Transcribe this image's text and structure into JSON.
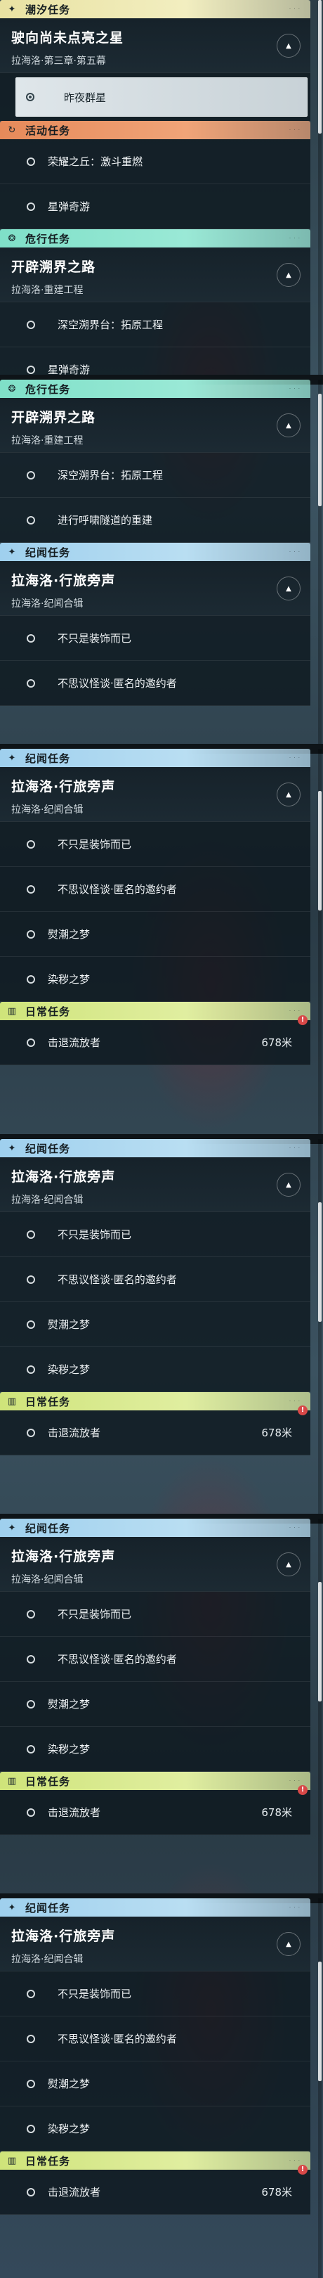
{
  "shots": [
    {
      "panel": [
        {
          "kind": "cat",
          "style": "gold",
          "icon": "✦",
          "icon_name": "sparkle-icon",
          "label": "潮汐任务"
        },
        {
          "kind": "head",
          "title": "驶向尚未点亮之星",
          "sub": "拉海洛·第三章·第五幕"
        },
        {
          "kind": "quest",
          "variant": "sel",
          "label": "昨夜群星"
        },
        {
          "kind": "cat",
          "style": "orange",
          "icon": "↻",
          "icon_name": "activity-icon",
          "label": "活动任务"
        },
        {
          "kind": "quest",
          "variant": "plain",
          "label": "荣耀之丘：激斗重燃"
        },
        {
          "kind": "quest",
          "variant": "plain",
          "label": "星弹奇游"
        },
        {
          "kind": "cat",
          "style": "teal",
          "icon": "❂",
          "icon_name": "danger-task-icon",
          "label": "危行任务"
        },
        {
          "kind": "head",
          "title": "开辟溯界之路",
          "sub": "拉海洛·重建工程"
        },
        {
          "kind": "quest",
          "variant": "sub",
          "label": "深空溯界台：拓原工程"
        },
        {
          "kind": "quest",
          "variant": "plain",
          "label": "星弹奇游"
        }
      ]
    },
    {
      "panel": [
        {
          "kind": "cat",
          "style": "teal",
          "icon": "❂",
          "icon_name": "danger-task-icon",
          "label": "危行任务"
        },
        {
          "kind": "head",
          "title": "开辟溯界之路",
          "sub": "拉海洛·重建工程"
        },
        {
          "kind": "quest",
          "variant": "sub",
          "label": "深空溯界台：拓原工程"
        },
        {
          "kind": "quest",
          "variant": "sub",
          "label": "进行呼啸隧道的重建"
        },
        {
          "kind": "cat",
          "style": "blue",
          "icon": "✦",
          "icon_name": "sparkle-icon",
          "label": "纪闻任务"
        },
        {
          "kind": "head",
          "title": "拉海洛·行旅旁声",
          "sub": "拉海洛·纪闻合辑"
        },
        {
          "kind": "quest",
          "variant": "sub",
          "label": "不只是装饰而已"
        },
        {
          "kind": "quest",
          "variant": "sub",
          "label": "不思议怪谈·匿名的邀约者"
        }
      ]
    },
    {
      "panel": [
        {
          "kind": "cat",
          "style": "blue",
          "icon": "✦",
          "icon_name": "sparkle-icon",
          "label": "纪闻任务"
        },
        {
          "kind": "head",
          "title": "拉海洛·行旅旁声",
          "sub": "拉海洛·纪闻合辑"
        },
        {
          "kind": "quest",
          "variant": "sub",
          "label": "不只是装饰而已"
        },
        {
          "kind": "quest",
          "variant": "sub",
          "label": "不思议怪谈·匿名的邀约者"
        },
        {
          "kind": "quest",
          "variant": "plain",
          "label": "熨潮之梦"
        },
        {
          "kind": "quest",
          "variant": "plain",
          "label": "染秽之梦"
        },
        {
          "kind": "cat",
          "style": "daily",
          "icon": "▥",
          "icon_name": "book-icon",
          "label": "日常任务"
        },
        {
          "kind": "quest",
          "variant": "plain",
          "label": "击退流放者",
          "dist": "678米",
          "alert": "!"
        }
      ]
    },
    {
      "panel": [
        {
          "kind": "cat",
          "style": "blue",
          "icon": "✦",
          "icon_name": "sparkle-icon",
          "label": "纪闻任务"
        },
        {
          "kind": "head",
          "title": "拉海洛·行旅旁声",
          "sub": "拉海洛·纪闻合辑"
        },
        {
          "kind": "quest",
          "variant": "sub",
          "label": "不只是装饰而已"
        },
        {
          "kind": "quest",
          "variant": "sub",
          "label": "不思议怪谈·匿名的邀约者"
        },
        {
          "kind": "quest",
          "variant": "plain",
          "label": "熨潮之梦"
        },
        {
          "kind": "quest",
          "variant": "plain",
          "label": "染秽之梦"
        },
        {
          "kind": "cat",
          "style": "daily",
          "icon": "▥",
          "icon_name": "book-icon",
          "label": "日常任务"
        },
        {
          "kind": "quest",
          "variant": "plain",
          "label": "击退流放者",
          "dist": "678米",
          "alert": "!"
        }
      ]
    },
    {
      "panel": [
        {
          "kind": "cat",
          "style": "blue",
          "icon": "✦",
          "icon_name": "sparkle-icon",
          "label": "纪闻任务"
        },
        {
          "kind": "head",
          "title": "拉海洛·行旅旁声",
          "sub": "拉海洛·纪闻合辑"
        },
        {
          "kind": "quest",
          "variant": "sub",
          "label": "不只是装饰而已"
        },
        {
          "kind": "quest",
          "variant": "sub",
          "label": "不思议怪谈·匿名的邀约者"
        },
        {
          "kind": "quest",
          "variant": "plain",
          "label": "熨潮之梦"
        },
        {
          "kind": "quest",
          "variant": "plain",
          "label": "染秽之梦"
        },
        {
          "kind": "cat",
          "style": "daily",
          "icon": "▥",
          "icon_name": "book-icon",
          "label": "日常任务"
        },
        {
          "kind": "quest",
          "variant": "plain",
          "label": "击退流放者",
          "dist": "678米",
          "alert": "!"
        }
      ]
    },
    {
      "panel": [
        {
          "kind": "cat",
          "style": "blue",
          "icon": "✦",
          "icon_name": "sparkle-icon",
          "label": "纪闻任务"
        },
        {
          "kind": "head",
          "title": "拉海洛·行旅旁声",
          "sub": "拉海洛·纪闻合辑"
        },
        {
          "kind": "quest",
          "variant": "sub",
          "label": "不只是装饰而已"
        },
        {
          "kind": "quest",
          "variant": "sub",
          "label": "不思议怪谈·匿名的邀约者"
        },
        {
          "kind": "quest",
          "variant": "plain",
          "label": "熨潮之梦"
        },
        {
          "kind": "quest",
          "variant": "plain",
          "label": "染秽之梦"
        },
        {
          "kind": "cat",
          "style": "daily",
          "icon": "▥",
          "icon_name": "book-icon",
          "label": "日常任务"
        },
        {
          "kind": "quest",
          "variant": "plain",
          "label": "击退流放者",
          "dist": "678米",
          "alert": "!"
        }
      ]
    }
  ]
}
